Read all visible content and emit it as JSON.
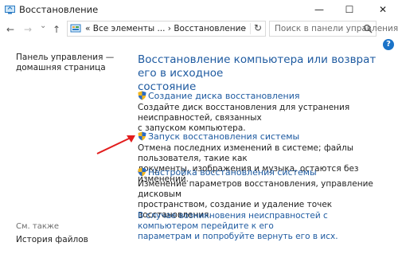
{
  "window": {
    "title": "Восстановление",
    "minimize_glyph": "—",
    "maximize_glyph": "☐",
    "close_glyph": "✕"
  },
  "nav": {
    "back_glyph": "←",
    "forward_glyph": "→",
    "history_glyph": "⌄",
    "up_glyph": "↑"
  },
  "address": {
    "path": "« Все элементы ... › Восстановление",
    "dropdown_glyph": "⌄",
    "refresh_glyph": "↻"
  },
  "search": {
    "placeholder": "Поиск в панели управления"
  },
  "help_glyph": "?",
  "sidebar": {
    "home_line1": "Панель управления —",
    "home_line2": "домашняя страница",
    "see_also": "См. также",
    "file_history": "История файлов"
  },
  "main": {
    "heading_line1": "Восстановление компьютера или возврат его в исходное",
    "heading_line2": "состояние",
    "items": [
      {
        "link": "Создание диска восстановления",
        "desc_line1": "Создайте диск восстановления для устранения неисправностей, связанных",
        "desc_line2": "с запуском компьютера."
      },
      {
        "link": "Запуск восстановления системы",
        "desc_line1": "Отмена последних изменений в системе; файлы пользователя, такие как",
        "desc_line2": "документы, изображения и музыка, остаются без изменений."
      },
      {
        "link": "Настройка восстановления системы",
        "desc_line1": "Изменение параметров восстановления, управление дисковым",
        "desc_line2": "пространством, создание и удаление точек восстановления."
      }
    ],
    "info_line1": "В случае возникновения неисправностей с компьютером перейдите к его",
    "info_line2": "параметрам и попробуйте вернуть его в исх."
  },
  "colors": {
    "link": "#1e5aa0",
    "arrow": "#e21d1d"
  }
}
